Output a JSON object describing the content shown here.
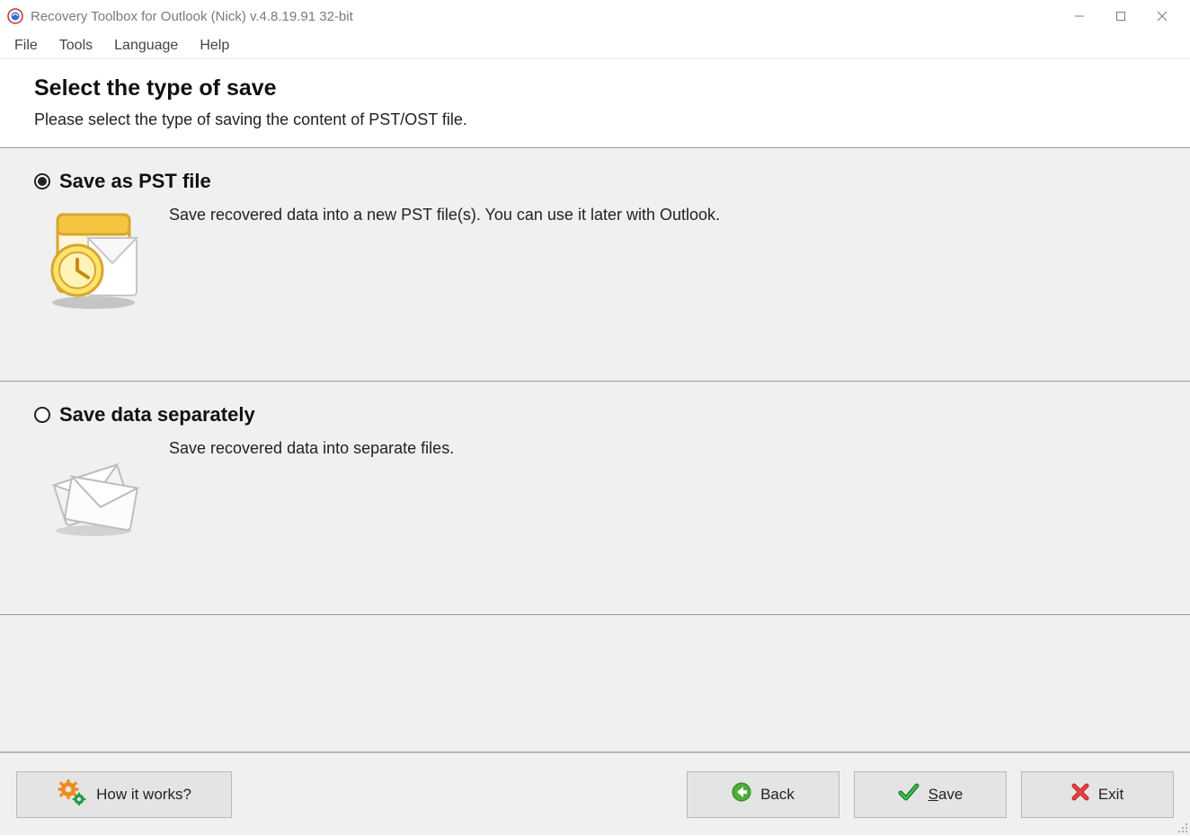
{
  "window": {
    "title": "Recovery Toolbox for Outlook (Nick) v.4.8.19.91 32-bit"
  },
  "menubar": {
    "items": [
      "File",
      "Tools",
      "Language",
      "Help"
    ]
  },
  "header": {
    "title": "Select the type of save",
    "subtitle": "Please select the type of saving the content of PST/OST file."
  },
  "options": [
    {
      "label": "Save as PST file",
      "description": "Save recovered data into a new PST file(s). You can use it later with Outlook.",
      "selected": true,
      "icon": "pst-icon"
    },
    {
      "label": "Save data separately",
      "description": "Save recovered data into separate files.",
      "selected": false,
      "icon": "envelope-icon"
    }
  ],
  "footer": {
    "how": "How it works?",
    "back": "Back",
    "save_prefix": "S",
    "save_rest": "ave",
    "exit": "Exit"
  }
}
